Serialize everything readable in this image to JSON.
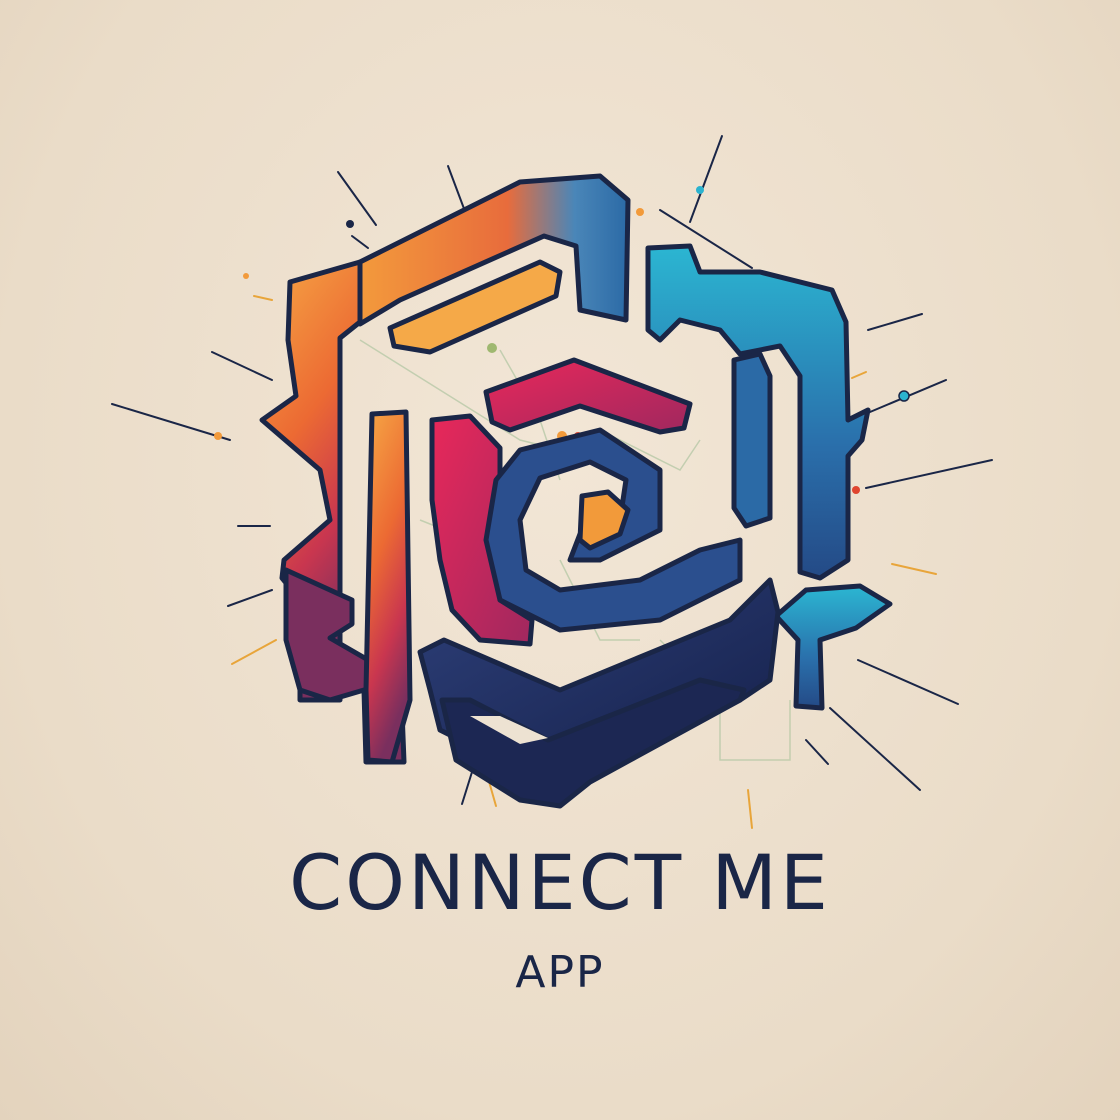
{
  "logo": {
    "icon": "hexagon-maze-knot-icon",
    "title": "CONNECT ME",
    "subtitle": "APP"
  },
  "colors": {
    "background": "#ede2d2",
    "navy": "#1a2647",
    "blue": "#2b5f9e",
    "cyan": "#2bb3cf",
    "orange": "#f29a3a",
    "red": "#e0452f",
    "magenta": "#d8265a",
    "plum": "#7a2f5e"
  }
}
